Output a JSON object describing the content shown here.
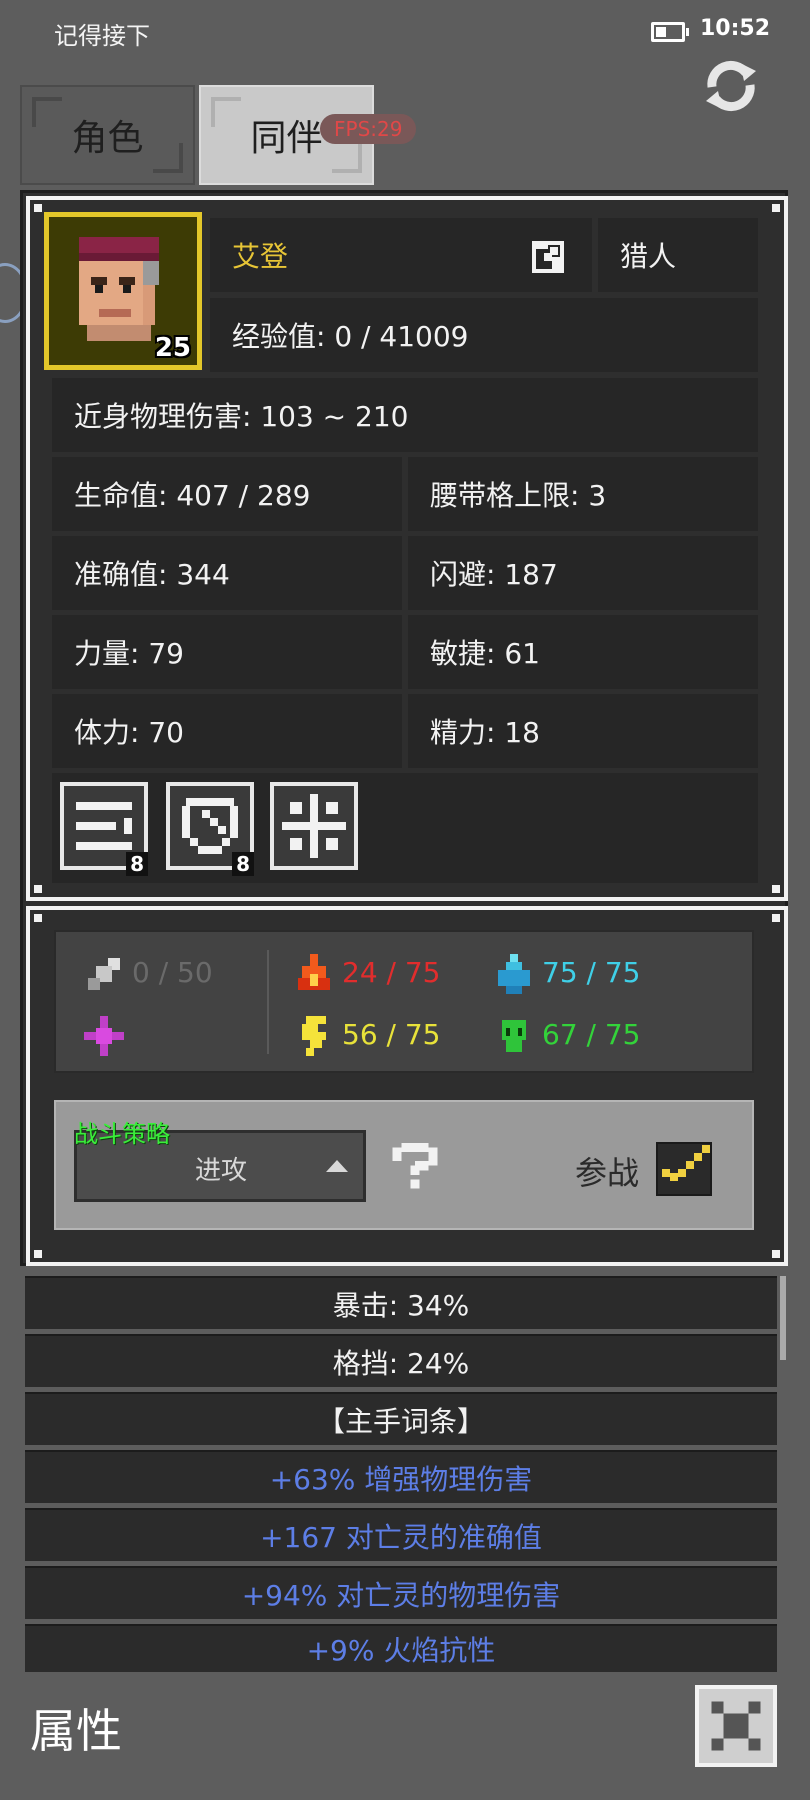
{
  "status_bar": {
    "app_name": "记得接下",
    "time": "10:52"
  },
  "tabs": [
    {
      "label": "角色",
      "active": false
    },
    {
      "label": "同伴",
      "active": true
    }
  ],
  "fps_badge": "FPS:29",
  "character": {
    "name": "艾登",
    "class": "猎人",
    "level": "25",
    "exp": "经验值: 0 / 41009",
    "melee": "近身物理伤害: 103 ~ 210",
    "stats": [
      "生命值: 407 / 289",
      "腰带格上限: 3",
      "准确值: 344",
      "闪避: 187",
      "力量: 79",
      "敏捷: 61",
      "体力: 70",
      "精力: 18"
    ],
    "skills": [
      {
        "icon": "bars-skill-icon",
        "count": "8"
      },
      {
        "icon": "shield-skill-icon",
        "count": "8"
      },
      {
        "icon": "crosshair-skill-icon",
        "count": ""
      }
    ]
  },
  "resistances": {
    "physical": "0 / 50",
    "fire": "24 / 75",
    "water": "75 / 75",
    "lightning": "56 / 75",
    "poison": "67 / 75",
    "colors": {
      "physical": "#6a6a6a",
      "fire": "#e12d2d",
      "water": "#3fd0e8",
      "lightning": "#e8e23a",
      "poison": "#33d33a",
      "arcane": "#5a4a5a"
    }
  },
  "tactics": {
    "label": "战斗策略",
    "value": "进攻",
    "join_label": "参战",
    "join_checked": true
  },
  "attributes": [
    {
      "text": "暴击: 34%",
      "affix": false
    },
    {
      "text": "格挡: 24%",
      "affix": false
    },
    {
      "text": "【主手词条】",
      "affix": false
    },
    {
      "text": "+63% 增强物理伤害",
      "affix": true
    },
    {
      "text": "+167 对亡灵的准确值",
      "affix": true
    },
    {
      "text": "+94% 对亡灵的物理伤害",
      "affix": true
    },
    {
      "text": "+9% 火焰抗性",
      "affix": true
    }
  ],
  "footer": {
    "title": "属性"
  }
}
